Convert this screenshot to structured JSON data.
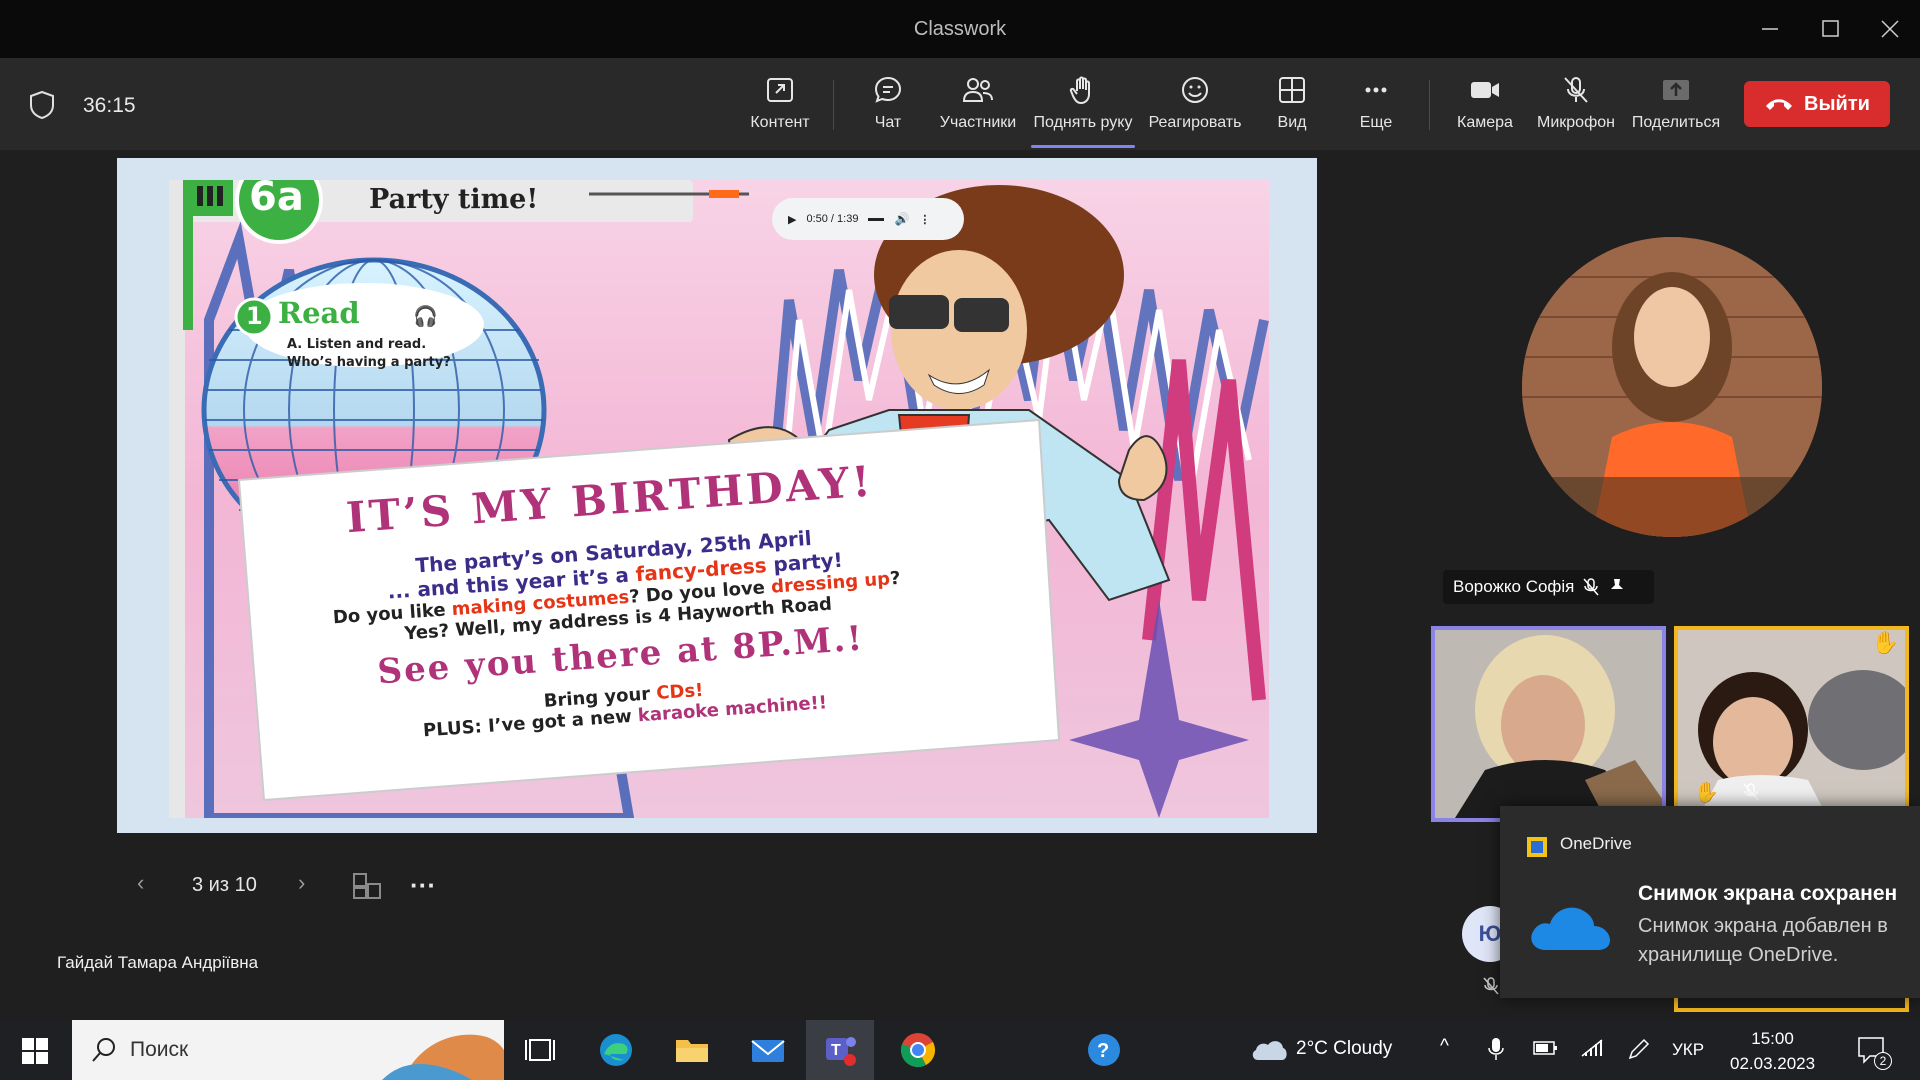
{
  "window": {
    "title": "Classwork"
  },
  "toolbar": {
    "timer": "36:15",
    "content": "Контент",
    "chat": "Чат",
    "participants": "Участники",
    "raise_hand": "Поднять руку",
    "react": "Реагировать",
    "view": "Вид",
    "more": "Еще",
    "camera": "Камера",
    "mic": "Микрофон",
    "share": "Поделиться",
    "leave": "Выйти"
  },
  "slide": {
    "unit": "6a",
    "heading": "Party time!",
    "audio_time": "0:50 / 1:39",
    "task_label": "Read",
    "task_number": "1",
    "task_text_1": "A. Listen and read.",
    "task_text_2": "Who’s having a party?",
    "banner": "IT’S MY BIRTHDAY!",
    "line1": "The party’s on Saturday, 25th April",
    "line2a": "... and this year it’s a ",
    "line2b": "fancy-dress",
    "line2c": " party!",
    "line3a": "Do you like ",
    "line3b": "making costumes",
    "line3c": "? Do you love ",
    "line3d": "dressing up",
    "line3e": "?",
    "line4": "Yes? Well, my address is 4 Hayworth Road",
    "line5": "See you there at 8P.M.!",
    "line6a": "Bring your ",
    "line6b": "CDs!",
    "line7a": "PLUS: I’ve got a new ",
    "line7b": "karaoke machine!!"
  },
  "slide_nav": {
    "page": "3 из 10"
  },
  "presenter": {
    "name": "Гайдай Тамара Андріївна"
  },
  "participants": {
    "featured_name": "Ворожко Софія",
    "initials": "Ю"
  },
  "toast": {
    "app": "OneDrive",
    "title": "Снимок экрана сохранен",
    "body": "Снимок экрана добавлен в хранилище OneDrive."
  },
  "taskbar": {
    "search_placeholder": "Поиск",
    "weather": "2°C  Cloudy",
    "lang": "УКР",
    "time": "15:00",
    "date": "02.03.2023",
    "notif_count": "2"
  },
  "colors": {
    "accent": "#7f85f5",
    "leave": "#d92c2c",
    "hand": "#f2b81e"
  }
}
